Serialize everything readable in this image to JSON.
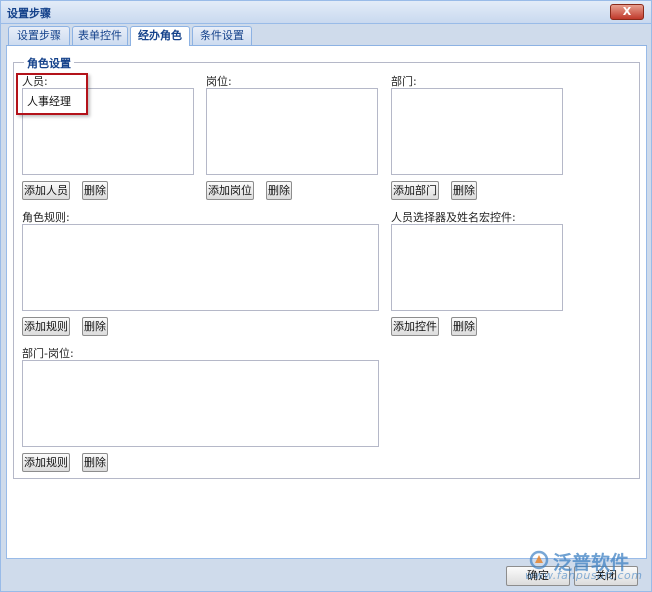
{
  "window": {
    "title": "设置步骤",
    "close_label": "X"
  },
  "tabs": [
    {
      "label": "设置步骤",
      "active": false
    },
    {
      "label": "表单控件",
      "active": false
    },
    {
      "label": "经办角色",
      "active": true
    },
    {
      "label": "条件设置",
      "active": false
    }
  ],
  "role_settings": {
    "legend": "角色设置",
    "personnel": {
      "label": "人员:",
      "items": [
        "人事经理"
      ],
      "add_label": "添加人员",
      "delete_label": "删除"
    },
    "position": {
      "label": "岗位:",
      "items": [],
      "add_label": "添加岗位",
      "delete_label": "删除"
    },
    "department": {
      "label": "部门:",
      "items": [],
      "add_label": "添加部门",
      "delete_label": "删除"
    },
    "role_rules": {
      "label": "角色规则:",
      "items": [],
      "add_label": "添加规则",
      "delete_label": "删除"
    },
    "selector_controls": {
      "label": "人员选择器及姓名宏控件:",
      "items": [],
      "add_label": "添加控件",
      "delete_label": "删除"
    },
    "dept_position": {
      "label": "部门-岗位:",
      "items": [],
      "add_label": "添加规则",
      "delete_label": "删除"
    }
  },
  "footer": {
    "ok_label": "确定",
    "close_label": "关闭"
  },
  "watermark": {
    "brand": "泛普软件",
    "url": "www.fanpusoft.com"
  },
  "colors": {
    "accent": "#15428b",
    "highlight": "#b3121a"
  }
}
